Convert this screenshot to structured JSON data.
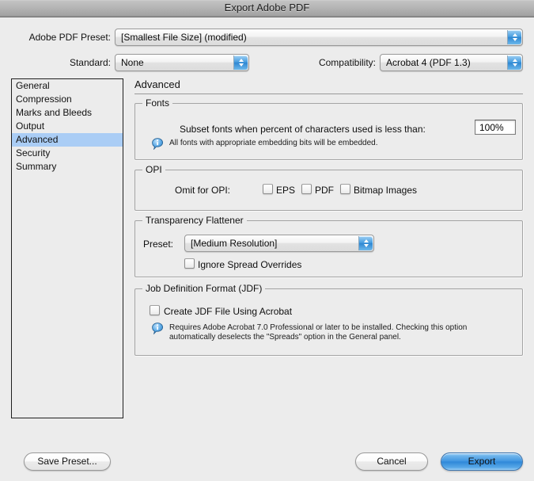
{
  "window": {
    "title": "Export Adobe PDF"
  },
  "top": {
    "preset_label": "Adobe PDF Preset:",
    "preset_value": "[Smallest File Size] (modified)",
    "standard_label": "Standard:",
    "standard_value": "None",
    "compatibility_label": "Compatibility:",
    "compatibility_value": "Acrobat 4 (PDF 1.3)"
  },
  "sidebar": {
    "items": [
      {
        "label": "General",
        "selected": false
      },
      {
        "label": "Compression",
        "selected": false
      },
      {
        "label": "Marks and Bleeds",
        "selected": false
      },
      {
        "label": "Output",
        "selected": false
      },
      {
        "label": "Advanced",
        "selected": true
      },
      {
        "label": "Security",
        "selected": false
      },
      {
        "label": "Summary",
        "selected": false
      }
    ],
    "selected_color": "#aacdf5"
  },
  "pane": {
    "title": "Advanced",
    "fonts": {
      "legend": "Fonts",
      "subset_label": "Subset fonts when percent of characters used is less than:",
      "subset_value": "100%",
      "note": "All fonts with appropriate embedding bits will be embedded."
    },
    "opi": {
      "legend": "OPI",
      "omit_label": "Omit for OPI:",
      "options": [
        {
          "label": "EPS",
          "checked": false
        },
        {
          "label": "PDF",
          "checked": false
        },
        {
          "label": "Bitmap Images",
          "checked": false
        }
      ]
    },
    "transparency": {
      "legend": "Transparency Flattener",
      "preset_label": "Preset:",
      "preset_value": "[Medium Resolution]",
      "ignore_spread_label": "Ignore Spread Overrides",
      "ignore_spread_checked": false
    },
    "jdf": {
      "legend": "Job Definition Format (JDF)",
      "create_label": "Create JDF File Using Acrobat",
      "create_checked": false,
      "note_line1": "Requires Adobe Acrobat 7.0 Professional or later to be installed. Checking this option",
      "note_line2": "automatically deselects the \"Spreads\" option in the General panel."
    }
  },
  "buttons": {
    "save_preset": "Save Preset...",
    "cancel": "Cancel",
    "export": "Export"
  }
}
